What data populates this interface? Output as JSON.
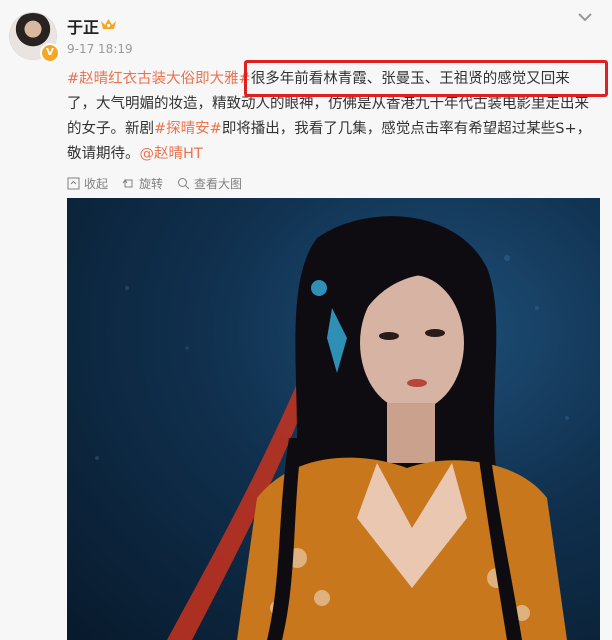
{
  "user": {
    "name": "于正",
    "verified_badge": "V",
    "time": "9-17 18:19",
    "avatar_icon": "avatar",
    "crown_icon": "crown-icon"
  },
  "post": {
    "hashtag1": "#赵晴红衣古装大俗即大雅#",
    "highlight": "很多年前看林青霞、张曼玉、王祖贤的感觉又回来",
    "text1": "了，大气明媚的妆造，精致动人的眼神，仿佛是从香港九十年代古装电影里走出来",
    "text2": "的女子。新剧",
    "hashtag2": "#探晴安#",
    "text3": "即将播出，我看了几集，感觉点击率有希望超过某些S+，",
    "text4": "敬请期待。",
    "mention": "@赵晴HT"
  },
  "actions": {
    "collapse": "收起",
    "rotate": "旋转",
    "view_large": "查看大图"
  },
  "colors": {
    "link": "#eb7350",
    "highlight_border": "#e02020",
    "photo_bg": "#10304e"
  }
}
